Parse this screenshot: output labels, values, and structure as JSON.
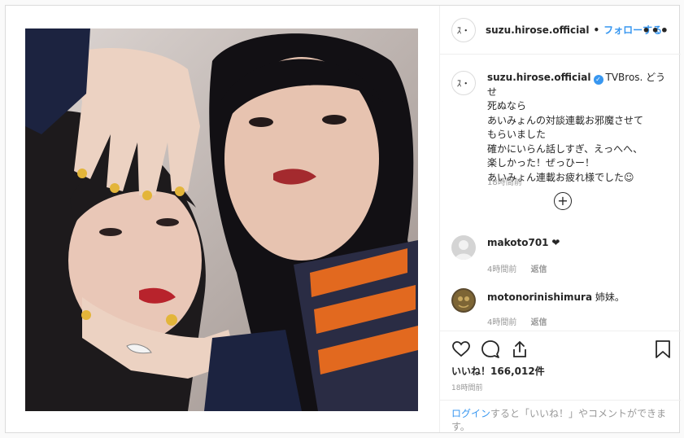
{
  "header": {
    "avatar_text": "ｽ・",
    "username": "suzu.hirose.official",
    "dot": "•",
    "follow_label": "フォローする",
    "more_label": "•••"
  },
  "caption": {
    "username": "suzu.hirose.official",
    "line1": "TVBros. どうせ",
    "lines": [
      "死ぬなら",
      "あいみょんの対談連載お邪魔させて",
      "もらいました",
      "確かにいらん話しすぎ、えっへへ、",
      "楽しかった！ぜっひー！",
      "あいみょん連載お疲れ様でした☺"
    ],
    "time": "18時間前"
  },
  "load_more_label": "+",
  "comments": [
    {
      "username": "makoto701",
      "text": "❤",
      "time": "4時間前",
      "reply_label": "返信"
    },
    {
      "username": "motonorinishimura",
      "text": "姉妹。",
      "time": "4時間前",
      "reply_label": "返信"
    }
  ],
  "likes": {
    "label": "いいね！",
    "count": "166,012件"
  },
  "post_time": "18時間前",
  "login_prompt": {
    "link": "ログイン",
    "rest": "すると「いいね！」やコメントができます。"
  },
  "icons": [
    "heart-icon",
    "comment-icon",
    "share-icon",
    "bookmark-icon",
    "plus-circle-icon",
    "verified-icon"
  ],
  "colors": {
    "link": "#3897f0",
    "muted": "#999999",
    "text": "#262626"
  }
}
